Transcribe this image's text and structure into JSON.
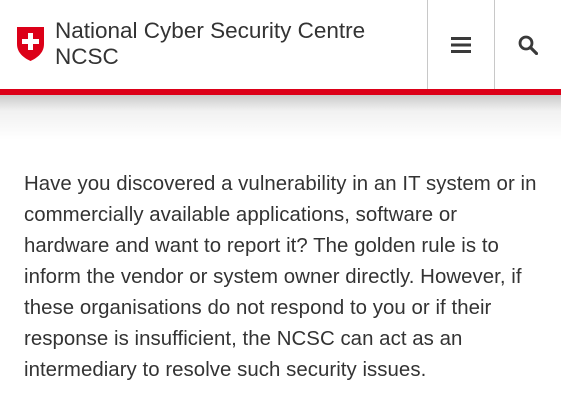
{
  "header": {
    "title_line1": "National Cyber Security Centre",
    "title_line2": "NCSC",
    "menu_icon": "hamburger-menu-icon",
    "search_icon": "magnifier-search-icon",
    "logo_icon": "swiss-cross-shield-icon"
  },
  "colors": {
    "accent_red": "#dc0018",
    "text": "#333333",
    "divider": "#c8c8c8"
  },
  "main": {
    "intro_paragraph": "Have you discovered a vulnerability in an IT system or in commercially available applications, software or hardware and want to report it? The golden rule is to inform the vendor or system owner directly. However, if these organisations do not respond to you or if their response is insufficient, the NCSC can act as an intermediary to resolve such security issues."
  }
}
